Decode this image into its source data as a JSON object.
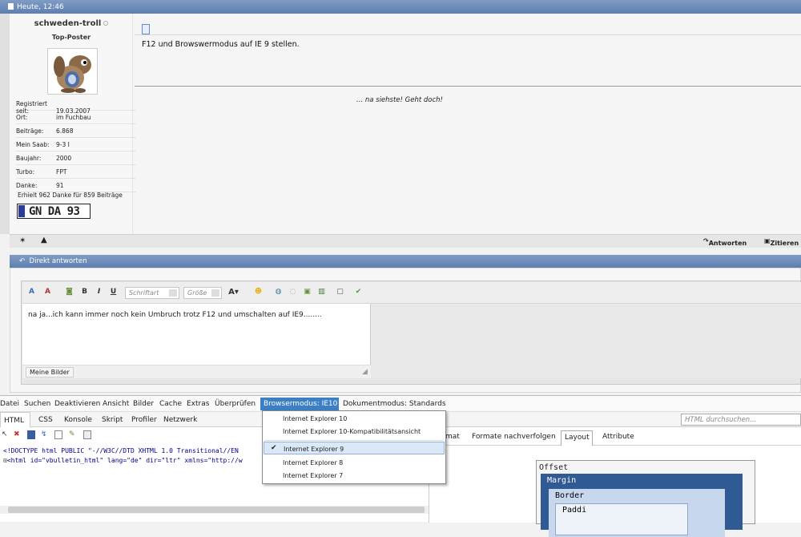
{
  "post": {
    "date": "Heute, 12:46",
    "username": "schweden-troll",
    "user_title": "Top-Poster",
    "info": [
      {
        "key": "Registriert seit:",
        "value": "19.03.2007"
      },
      {
        "key": "Ort:",
        "value": "im Fuchbau"
      },
      {
        "key": "Beiträge:",
        "value": "6.868"
      },
      {
        "key": "Mein Saab:",
        "value": "9-3 I"
      },
      {
        "key": "Baujahr:",
        "value": "2000"
      },
      {
        "key": "Turbo:",
        "value": "FPT"
      },
      {
        "key": "Danke:",
        "value": "91"
      }
    ],
    "thanks_line": "Erhielt 962 Danke für 859 Beiträge",
    "plate": "GN DA 93",
    "message": "F12 und Browswermodus auf IE 9 stellen.",
    "signature": "... na siehste! Geht doch!",
    "reply_label": "Antworten",
    "quote_label": "Zitieren"
  },
  "reply": {
    "header": "Direkt antworten",
    "font_placeholder": "Schriftart",
    "size_placeholder": "Größe",
    "text": "na ja...ich kann immer noch kein Umbruch trotz F12 und umschalten auf IE9........",
    "my_pictures": "Meine Bilder"
  },
  "devtools": {
    "menu": [
      "Datei",
      "Suchen",
      "Deaktivieren",
      "Ansicht",
      "Bilder",
      "Cache",
      "Extras",
      "Überprüfen"
    ],
    "browser_mode": "Browsermodus: IE10",
    "document_mode": "Dokumentmodus: Standards",
    "tabs": [
      "HTML",
      "CSS",
      "Konsole",
      "Skript",
      "Profiler",
      "Netzwerk"
    ],
    "search_placeholder": "HTML durchsuchen...",
    "code_lines": [
      "<!DOCTYPE html PUBLIC \"-//W3C//DTD XHTML 1.0 Transitional//EN",
      "<html id=\"vbulletin_html\" lang=\"de\" dir=\"ltr\" xmlns=\"http://w"
    ],
    "right_tabs": [
      "mat",
      "Formate nachverfolgen",
      "Layout",
      "Attribute"
    ],
    "box_model": {
      "offset": "Offset",
      "margin": "Margin",
      "border": "Border",
      "padding": "Paddi"
    },
    "dropdown": [
      {
        "label": "Internet Explorer 10",
        "selected": false
      },
      {
        "label": "Internet Explorer 10-Kompatibilitätsansicht",
        "selected": false
      },
      {
        "label": "Internet Explorer 9",
        "selected": true
      },
      {
        "label": "Internet Explorer 8",
        "selected": false
      },
      {
        "label": "Internet Explorer 7",
        "selected": false
      }
    ]
  },
  "colors": {
    "header_blue": "#5d7fb0",
    "selection_blue": "#3c7fc4",
    "box_margin": "#2f5a94"
  }
}
